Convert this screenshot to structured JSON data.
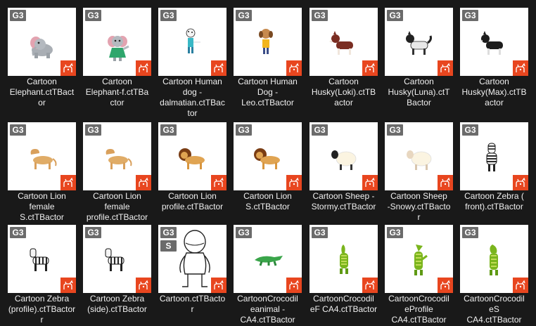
{
  "browser": {
    "items": [
      {
        "label": "Cartoon\nElephant.ctTBact\nor",
        "badges": [
          "G3"
        ],
        "icon": "elephant-icon"
      },
      {
        "label": "Cartoon\nElephant-f.ctTBa\nctor",
        "badges": [
          "G3"
        ],
        "icon": "elephant-female-icon"
      },
      {
        "label": "Cartoon Human\ndog -\ndalmatian.ctTBac\ntor",
        "badges": [
          "G3"
        ],
        "icon": "dalmatian-dog-icon"
      },
      {
        "label": "Cartoon Human\nDog -\nLeo.ctTBactor",
        "badges": [
          "G3"
        ],
        "icon": "leo-dog-icon"
      },
      {
        "label": "Cartoon\nHusky(Loki).ctTB\nactor",
        "badges": [
          "G3"
        ],
        "icon": "husky-loki-icon"
      },
      {
        "label": "Cartoon\nHusky(Luna).ctT\nBactor",
        "badges": [
          "G3"
        ],
        "icon": "husky-luna-icon"
      },
      {
        "label": "Cartoon\nHusky(Max).ctTB\nactor",
        "badges": [
          "G3"
        ],
        "icon": "husky-max-icon"
      },
      {
        "label": "Cartoon Lion\nfemale\nS.ctTBactor",
        "badges": [
          "G3"
        ],
        "icon": "lioness-icon"
      },
      {
        "label": "Cartoon Lion\nfemale\nprofile.ctTBactor",
        "badges": [
          "G3"
        ],
        "icon": "lioness-profile-icon"
      },
      {
        "label": "Cartoon Lion\nprofile.ctTBactor",
        "badges": [
          "G3"
        ],
        "icon": "lion-profile-icon"
      },
      {
        "label": "Cartoon Lion\nS.ctTBactor",
        "badges": [
          "G3"
        ],
        "icon": "lion-icon"
      },
      {
        "label": "Cartoon Sheep -\nStormy.ctTBactor",
        "badges": [
          "G3"
        ],
        "icon": "sheep-stormy-icon"
      },
      {
        "label": "Cartoon Sheep\n-Snowy.ctTBacto\nr",
        "badges": [
          "G3"
        ],
        "icon": "sheep-snowy-icon"
      },
      {
        "label": "Cartoon Zebra (\nfront).ctTBactor",
        "badges": [
          "G3"
        ],
        "icon": "zebra-front-icon"
      },
      {
        "label": "Cartoon Zebra\n(profile).ctTBactor\nr",
        "badges": [
          "G3"
        ],
        "icon": "zebra-profile-icon"
      },
      {
        "label": "Cartoon Zebra\n(side).ctTBactor",
        "badges": [
          "G3"
        ],
        "icon": "zebra-side-icon"
      },
      {
        "label": "Cartoon.ctTBacto\nr",
        "badges": [
          "G3",
          "S"
        ],
        "icon": "cartoon-figure-icon"
      },
      {
        "label": "CartoonCrocodil\neanimal -\nCA4.ctTBactor",
        "badges": [
          "G3"
        ],
        "icon": "crocodile-animal-icon"
      },
      {
        "label": "CartoonCrocodil\neF CA4.ctTBactor",
        "badges": [
          "G3"
        ],
        "icon": "crocodile-f-icon"
      },
      {
        "label": "CartoonCrocodil\neProfile\nCA4.ctTBactor",
        "badges": [
          "G3"
        ],
        "icon": "crocodile-profile-icon"
      },
      {
        "label": "CartoonCrocodil\neS\nCA4.ctTBactor",
        "badges": [
          "G3"
        ],
        "icon": "crocodile-s-icon"
      }
    ]
  },
  "colors": {
    "background": "#191919",
    "thumb": "#ffffff",
    "badge": "#6b6b6b",
    "actor_icon": "#e8461f",
    "label": "#f0f0f0"
  }
}
